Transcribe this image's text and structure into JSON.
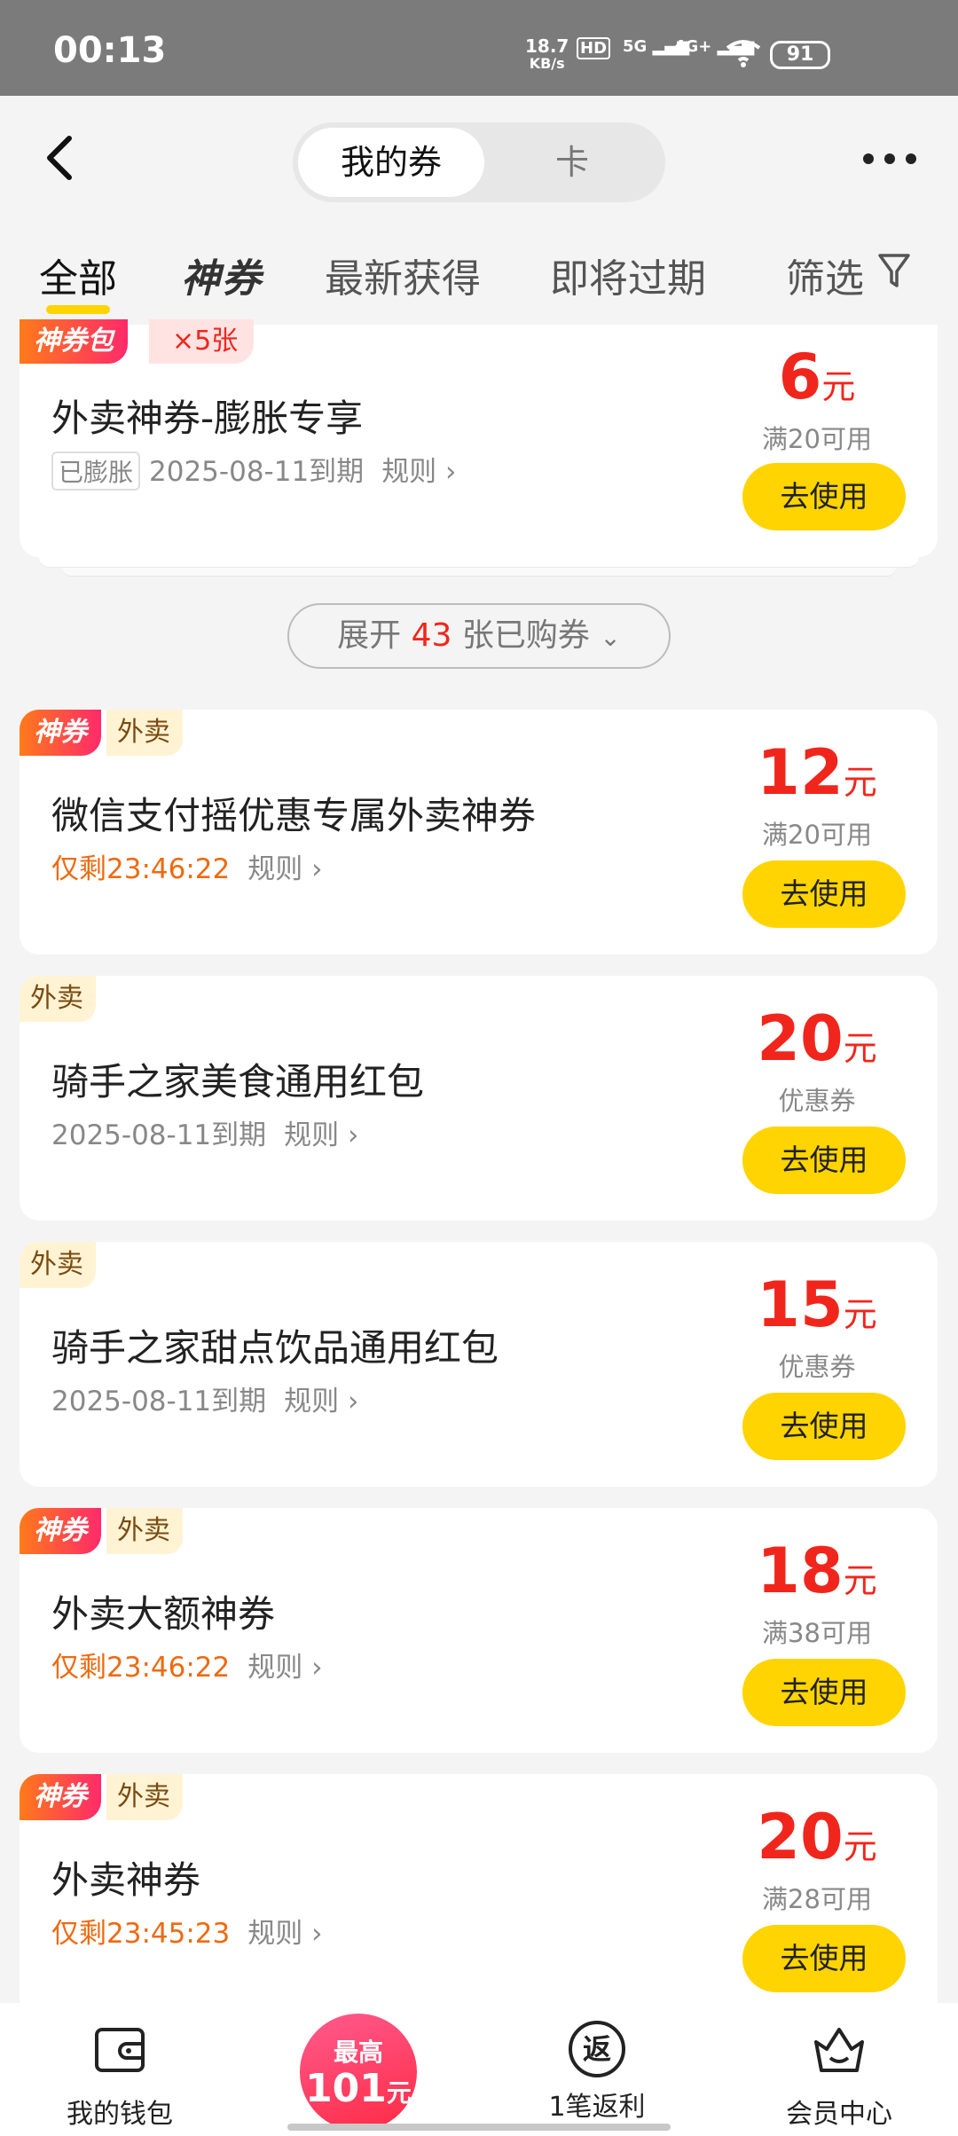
{
  "status_bar": {
    "time": "00:13",
    "net_speed_value": "18.7",
    "net_speed_unit": "KB/s",
    "hd_label": "HD",
    "sim1_label": "5G",
    "sim2_label": "4G+",
    "battery": "91"
  },
  "header": {
    "segment_left": "我的券",
    "segment_right": "卡"
  },
  "tabs": [
    {
      "label": "全部"
    },
    {
      "label": "神券"
    },
    {
      "label": "最新获得"
    },
    {
      "label": "即将过期"
    },
    {
      "label": "筛选"
    }
  ],
  "bundle_card": {
    "tag": "神券包",
    "count": "×5张",
    "title": "外卖神券-膨胀专享",
    "badge": "已膨胀",
    "expiry": "2025-08-11到期",
    "rule": "规则",
    "amount": "6",
    "unit": "元",
    "condition": "满20可用",
    "button": "去使用"
  },
  "expand": {
    "prefix": "展开",
    "count": "43",
    "suffix": "张已购券"
  },
  "coupons": [
    {
      "tag_shen": "神券",
      "tag_cat": "外卖",
      "title": "微信支付摇优惠专属外卖神券",
      "meta": "仅剩23:46:22",
      "meta_orange": true,
      "rule": "规则",
      "amount": "12",
      "unit": "元",
      "condition": "满20可用",
      "button": "去使用"
    },
    {
      "tag_shen": "",
      "tag_cat": "外卖",
      "title": "骑手之家美食通用红包",
      "meta": "2025-08-11到期",
      "meta_orange": false,
      "rule": "规则",
      "amount": "20",
      "unit": "元",
      "condition": "优惠券",
      "button": "去使用"
    },
    {
      "tag_shen": "",
      "tag_cat": "外卖",
      "title": "骑手之家甜点饮品通用红包",
      "meta": "2025-08-11到期",
      "meta_orange": false,
      "rule": "规则",
      "amount": "15",
      "unit": "元",
      "condition": "优惠券",
      "button": "去使用"
    },
    {
      "tag_shen": "神券",
      "tag_cat": "外卖",
      "title": "外卖大额神券",
      "meta": "仅剩23:46:22",
      "meta_orange": true,
      "rule": "规则",
      "amount": "18",
      "unit": "元",
      "condition": "满38可用",
      "button": "去使用"
    },
    {
      "tag_shen": "神券",
      "tag_cat": "外卖",
      "title": "外卖神券",
      "meta": "仅剩23:45:23",
      "meta_orange": true,
      "rule": "规则",
      "amount": "20",
      "unit": "元",
      "condition": "满28可用",
      "button": "去使用"
    }
  ],
  "bottom_nav": {
    "wallet": "我的钱包",
    "promo_top": "最高",
    "promo_amount": "101",
    "promo_unit": "元",
    "rebate_icon_char": "返",
    "rebate": "1笔返利",
    "member": "会员中心"
  },
  "colors": {
    "accent_yellow": "#ffd400",
    "price_red": "#f0261c",
    "countdown_orange": "#ee6a10"
  }
}
